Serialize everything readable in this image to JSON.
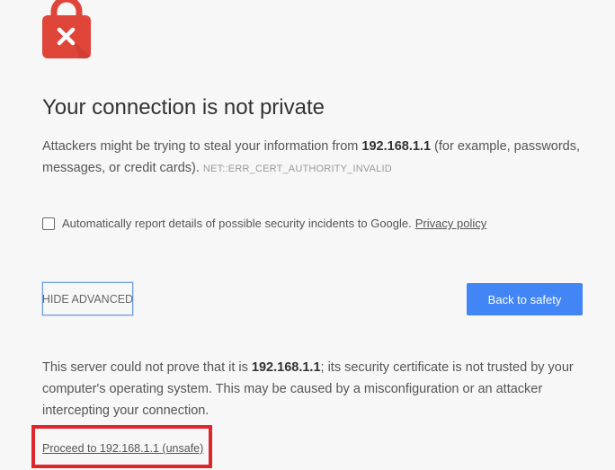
{
  "icons": {
    "lock": "lock-icon",
    "close": "close-icon"
  },
  "colors": {
    "lock_red": "#e0453a",
    "primary_button": "#4285f4",
    "highlight_box": "#e0252b"
  },
  "heading": "Your connection is not private",
  "description": {
    "before_host": "Attackers might be trying to steal your information from ",
    "host": "192.168.1.1",
    "after_host": " (for example, passwords, messages, or credit cards).",
    "error_code": "NET::ERR_CERT_AUTHORITY_INVALID"
  },
  "report": {
    "label": "Automatically report details of possible security incidents to Google.",
    "privacy_link": "Privacy policy",
    "checked": false
  },
  "buttons": {
    "hide_advanced": "HIDE ADVANCED",
    "back_to_safety": "Back to safety"
  },
  "details": {
    "before_host": "This server could not prove that it is ",
    "host": "192.168.1.1",
    "after_host": "; its security certificate is not trusted by your computer's operating system. This may be caused by a misconfiguration or an attacker intercepting your connection."
  },
  "proceed_link": "Proceed to 192.168.1.1 (unsafe)"
}
